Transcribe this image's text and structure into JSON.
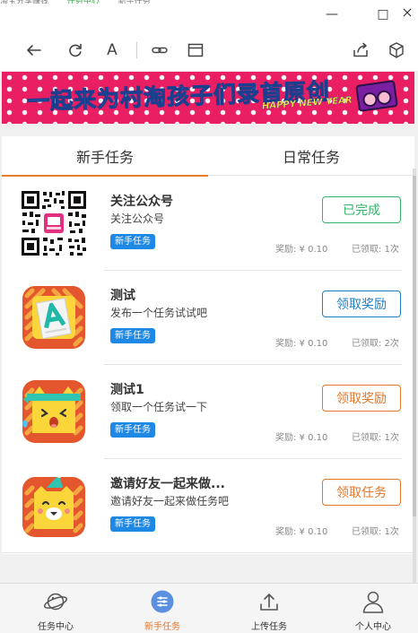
{
  "window": {
    "tab_strip": [
      "淘宝分享赚钱",
      "任务中心",
      "新手任务"
    ],
    "controls": {
      "minimize": "—",
      "maximize": "□",
      "close": "✕"
    }
  },
  "toolbar": {
    "icons": [
      "back-arrow-icon",
      "refresh-icon",
      "font-size-icon",
      "link-icon",
      "window-icon",
      "share-icon",
      "cube-icon"
    ],
    "font_label": "A"
  },
  "banner": {
    "title": "一起来为村淘孩子们录首原创",
    "subtitle": "HAPPY NEW YEAR",
    "colors": {
      "background": "#e91e63",
      "title": "#5ad1e4"
    }
  },
  "tabs": [
    {
      "label": "新手任务",
      "active": true
    },
    {
      "label": "日常任务",
      "active": false
    }
  ],
  "tasks": [
    {
      "thumb": "qrcode",
      "name": "关注公众号",
      "desc": "关注公众号",
      "badge": "新手任务",
      "reward": "奖励: ¥ 0.10",
      "claimed": "已领取: 1次",
      "button": "已完成",
      "button_style": "green"
    },
    {
      "thumb": "document-a",
      "name": "测试",
      "desc": "发布一个任务试试吧",
      "badge": "新手任务",
      "reward": "奖励: ¥ 0.10",
      "claimed": "已领取: 2次",
      "button": "领取奖励",
      "button_style": "blue"
    },
    {
      "thumb": "cat-headband",
      "name": "测试1",
      "desc": "领取一个任务试一下",
      "badge": "新手任务",
      "reward": "奖励: ¥ 0.10",
      "claimed": "已领取: 1次",
      "button": "领取奖励",
      "button_style": "orange"
    },
    {
      "thumb": "cat-party-hat",
      "name": "邀请好友一起来做...",
      "desc": "邀请好友一起来做任务吧",
      "badge": "新手任务",
      "reward": "奖励: ¥ 0.10",
      "claimed": "已领取: 1次",
      "button": "领取任务",
      "button_style": "orange"
    }
  ],
  "bottom_nav": [
    {
      "label": "任务中心",
      "icon": "planet-icon",
      "active": false
    },
    {
      "label": "新手任务",
      "icon": "list-icon",
      "active": true
    },
    {
      "label": "上传任务",
      "icon": "upload-icon",
      "active": false
    },
    {
      "label": "个人中心",
      "icon": "user-icon",
      "active": false
    }
  ],
  "colors": {
    "accent": "#e3772a",
    "badge": "#1e88e5",
    "done": "#35b46a",
    "claim": "#1e7fc4"
  }
}
